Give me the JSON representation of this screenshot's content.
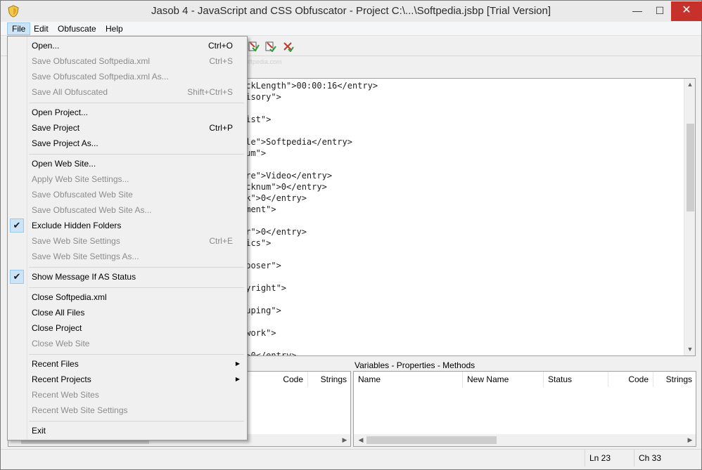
{
  "window": {
    "title": "Jasob 4 - JavaScript and CSS Obfuscator - Project  C:\\...\\Softpedia.jsbp  [Trial Version]",
    "minimize_glyph": "—",
    "maximize_glyph": "☐",
    "close_glyph": "✕"
  },
  "menubar": {
    "items": [
      {
        "label": "File"
      },
      {
        "label": "Edit"
      },
      {
        "label": "Obfuscate"
      },
      {
        "label": "Help"
      }
    ]
  },
  "watermark": {
    "main": "SOFTPEDIA",
    "sub": "www.softpedia.com"
  },
  "file_menu": {
    "items": [
      {
        "label": "Open...",
        "shortcut": "Ctrl+O",
        "enabled": true
      },
      {
        "label": "Save Obfuscated Softpedia.xml",
        "shortcut": "Ctrl+S",
        "enabled": false
      },
      {
        "label": "Save Obfuscated Softpedia.xml As...",
        "shortcut": "",
        "enabled": false
      },
      {
        "label": "Save All Obfuscated",
        "shortcut": "Shift+Ctrl+S",
        "enabled": false
      },
      {
        "label": "Open Project...",
        "shortcut": "",
        "enabled": true
      },
      {
        "label": "Save Project",
        "shortcut": "Ctrl+P",
        "enabled": true
      },
      {
        "label": "Save Project As...",
        "shortcut": "",
        "enabled": true
      },
      {
        "label": "Open Web Site...",
        "shortcut": "",
        "enabled": true
      },
      {
        "label": "Apply Web Site Settings...",
        "shortcut": "",
        "enabled": false
      },
      {
        "label": "Save Obfuscated Web Site",
        "shortcut": "",
        "enabled": false
      },
      {
        "label": "Save Obfuscated Web Site As...",
        "shortcut": "",
        "enabled": false
      },
      {
        "label": "Exclude Hidden Folders",
        "shortcut": "",
        "enabled": true,
        "checked": true
      },
      {
        "label": "Save Web Site Settings",
        "shortcut": "Ctrl+E",
        "enabled": false
      },
      {
        "label": "Save Web Site Settings As...",
        "shortcut": "",
        "enabled": false
      },
      {
        "label": "Show Message If AS Status",
        "shortcut": "",
        "enabled": true,
        "checked": true
      },
      {
        "label": "Close Softpedia.xml",
        "shortcut": "",
        "enabled": true
      },
      {
        "label": "Close All Files",
        "shortcut": "",
        "enabled": true
      },
      {
        "label": "Close Project",
        "shortcut": "",
        "enabled": true
      },
      {
        "label": "Close Web Site",
        "shortcut": "",
        "enabled": false
      },
      {
        "label": "Recent Files",
        "shortcut": "",
        "enabled": true,
        "submenu": true
      },
      {
        "label": "Recent Projects",
        "shortcut": "",
        "enabled": true,
        "submenu": true
      },
      {
        "label": "Recent Web Sites",
        "shortcut": "",
        "enabled": false
      },
      {
        "label": "Recent Web Site Settings",
        "shortcut": "",
        "enabled": false
      },
      {
        "label": "Exit",
        "shortcut": "",
        "enabled": true
      }
    ]
  },
  "editor": {
    "lines": [
      "ackLength\">00:00:16</entry>",
      "visory\">",
      "",
      "tist\">",
      "",
      "tle\">Softpedia</entry>",
      "bum\">",
      "",
      "nre\">Video</entry>",
      "acknum\">0</entry>",
      "sk\">0</entry>",
      "mment\">",
      "",
      "ar\">0</entry>",
      "rics\">",
      "",
      "mposer\">",
      "",
      "pyright\">",
      "",
      "ouping\">",
      "",
      "twork\">",
      "",
      "\">0</entry>"
    ]
  },
  "left_panel": {
    "columns": [
      "Code",
      "Strings"
    ]
  },
  "right_panel": {
    "title": "Variables - Properties - Methods",
    "columns": [
      "Name",
      "New Name",
      "Status",
      "Code",
      "Strings"
    ]
  },
  "statusbar": {
    "line": "Ln 23",
    "col": "Ch 33"
  },
  "colors": {
    "close_button": "#c7312b",
    "menu_highlight": "#cce4f7",
    "menu_highlight_border": "#99c9ef",
    "disabled_text": "#8c8c8c"
  },
  "icons": {
    "app": "shield-icon",
    "check": "checkmark-icon",
    "submenu": "chevron-right-icon"
  }
}
